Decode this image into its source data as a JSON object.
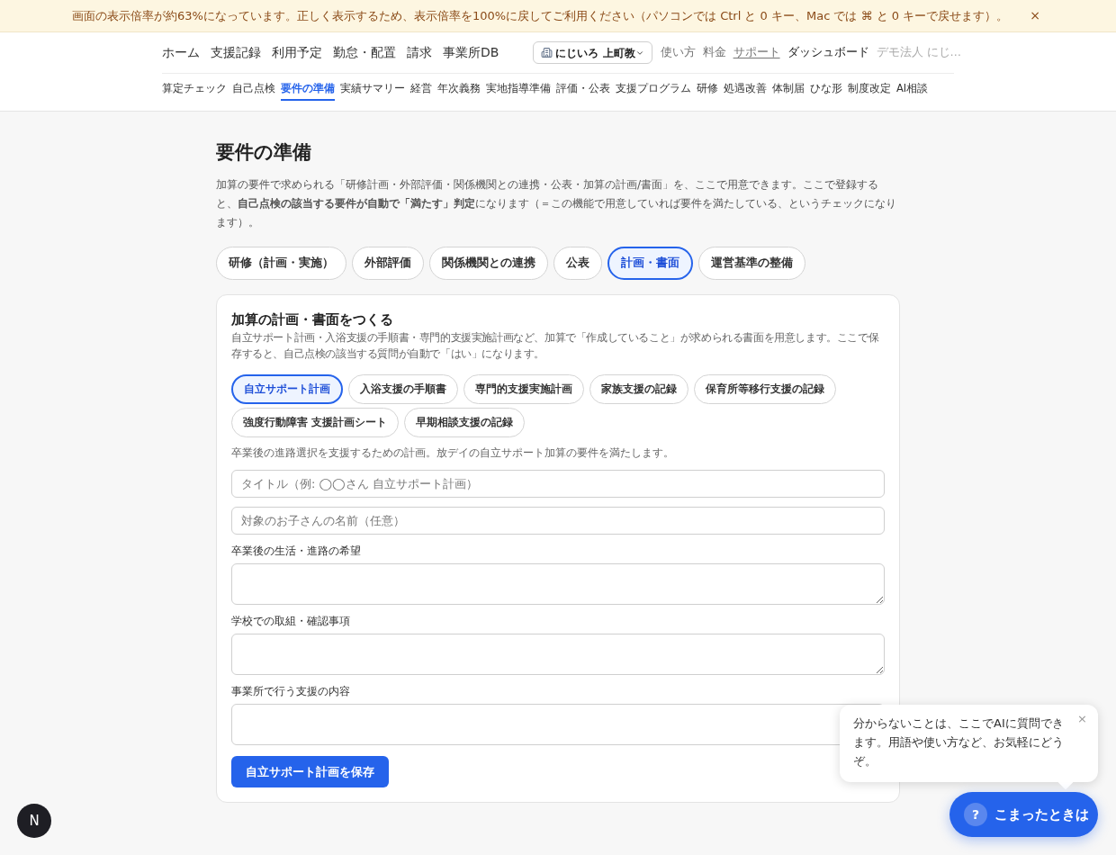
{
  "banner": {
    "message": "画面の表示倍率が約63%になっています。正しく表示するため、表示倍率を100%に戻してご利用ください（パソコンでは Ctrl と 0 キー、Mac では ⌘ と 0 キーで戻せます）。",
    "close": "×"
  },
  "header": {
    "main_nav": [
      {
        "label": "ホーム"
      },
      {
        "label": "支援記録"
      },
      {
        "label": "利用予定"
      },
      {
        "label": "勤怠・配置"
      },
      {
        "label": "請求"
      },
      {
        "label": "事業所DB"
      }
    ],
    "office_select": {
      "value": "にじいろ 上町教"
    },
    "links": [
      {
        "label": "使い方",
        "kind": "link"
      },
      {
        "label": "料金",
        "kind": "link"
      },
      {
        "label": "サポート",
        "kind": "underlined"
      },
      {
        "label": "ダッシュボード",
        "kind": "strong"
      },
      {
        "label": "デモ法人 にじ…",
        "kind": "muted"
      }
    ],
    "sub_nav": [
      {
        "label": "算定チェック",
        "selected": false
      },
      {
        "label": "自己点検",
        "selected": false
      },
      {
        "label": "要件の準備",
        "selected": true
      },
      {
        "label": "実績サマリー",
        "selected": false
      },
      {
        "label": "経営",
        "selected": false
      },
      {
        "label": "年次義務",
        "selected": false
      },
      {
        "label": "実地指導準備",
        "selected": false
      },
      {
        "label": "評価・公表",
        "selected": false
      },
      {
        "label": "支援プログラム",
        "selected": false
      },
      {
        "label": "研修",
        "selected": false
      },
      {
        "label": "処遇改善",
        "selected": false
      },
      {
        "label": "体制届",
        "selected": false
      },
      {
        "label": "ひな形",
        "selected": false
      },
      {
        "label": "制度改定",
        "selected": false
      },
      {
        "label": "AI相談",
        "selected": false
      }
    ]
  },
  "page": {
    "title": "要件の準備",
    "description": "加算の要件で求められる「研修計画・外部評価・関係機関との連携・公表・加算の計画/書面」を、ここで用意できます。ここで登録すると、**自己点検の該当する要件が自動で「満たす」判定**になります（＝この機能で用意していれば要件を満たしている、というチェックになります）。"
  },
  "tabs": [
    {
      "label": "研修（計画・実施）",
      "selected": false
    },
    {
      "label": "外部評価",
      "selected": false
    },
    {
      "label": "関係機関との連携",
      "selected": false
    },
    {
      "label": "公表",
      "selected": false
    },
    {
      "label": "計画・書面",
      "selected": true
    },
    {
      "label": "運営基準の整備",
      "selected": false
    }
  ],
  "card": {
    "title": "加算の計画・書面をつくる",
    "description": "自立サポート計画・入浴支援の手順書・専門的支援実施計画など、加算で「作成していること」が求められる書面を用意します。ここで保存すると、自己点検の該当する質問が自動で「はい」になります。",
    "doc_types": [
      {
        "label": "自立サポート計画",
        "selected": true
      },
      {
        "label": "入浴支援の手順書",
        "selected": false
      },
      {
        "label": "専門的支援実施計画",
        "selected": false
      },
      {
        "label": "家族支援の記録",
        "selected": false
      },
      {
        "label": "保育所等移行支援の記録",
        "selected": false
      },
      {
        "label": "強度行動障害 支援計画シート",
        "selected": false
      },
      {
        "label": "早期相談支援の記録",
        "selected": false
      }
    ],
    "doc_help": "卒業後の進路選択を支援するための計画。放デイの自立サポート加算の要件を満たします。",
    "fields": [
      {
        "kind": "input",
        "placeholder": "タイトル（例: ◯◯さん 自立サポート計画）"
      },
      {
        "kind": "input",
        "placeholder": "対象のお子さんの名前（任意）"
      },
      {
        "kind": "textarea",
        "label": "卒業後の生活・進路の希望"
      },
      {
        "kind": "textarea",
        "label": "学校での取組・確認事項"
      },
      {
        "kind": "textarea",
        "label": "事業所で行う支援の内容"
      }
    ],
    "save_button": "自立サポート計画を保存"
  },
  "help": {
    "popover": {
      "message": "分からないことは、ここでAIに質問できます。用語や使い方など、お気軽にどうぞ。",
      "close": "×"
    },
    "button": {
      "icon_text": "?",
      "label": "こまったときは"
    }
  },
  "dev_badge": {
    "label": "N"
  }
}
